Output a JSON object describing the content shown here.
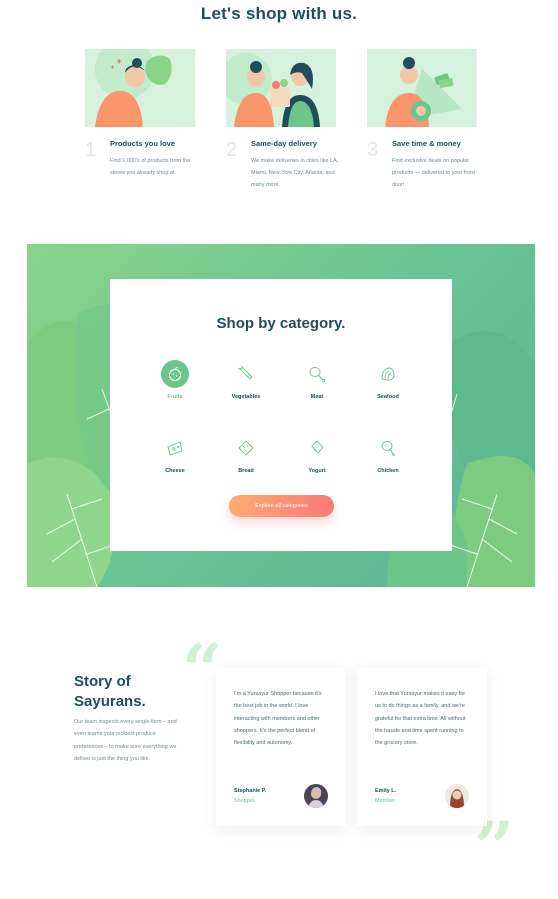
{
  "header": {
    "title": "Let's shop with us."
  },
  "features": [
    {
      "number": "1",
      "title": "Products you love",
      "description": "Find 1,000's of products from the stores you already shop at."
    },
    {
      "number": "2",
      "title": "Same-day delivery",
      "description": "We make deliveries in cities like LA, Miami, New York City, Atlanta, and many more."
    },
    {
      "number": "3",
      "title": "Save time & money",
      "description": "Find exclusive deals on popular products — delivered to your front door!"
    }
  ],
  "category": {
    "title": "Shop by category.",
    "items": [
      {
        "label": "Fruits",
        "icon": "fruit-icon",
        "active": true
      },
      {
        "label": "Vegetables",
        "icon": "vegetable-icon"
      },
      {
        "label": "Meat",
        "icon": "meat-icon"
      },
      {
        "label": "Seafood",
        "icon": "seafood-icon"
      },
      {
        "label": "Cheese",
        "icon": "cheese-icon"
      },
      {
        "label": "Bread",
        "icon": "bread-icon"
      },
      {
        "label": "Yogurt",
        "icon": "yogurt-icon"
      },
      {
        "label": "Chicken",
        "icon": "chicken-icon"
      }
    ],
    "button_label": "Explore all categories"
  },
  "story": {
    "title": "Story of Sayurans.",
    "description": "Our team inspects every single item – and even learns your pickiest produce preferences – to make sure everything we deliver is just the thing you like."
  },
  "testimonials": [
    {
      "text": "I'm a Yursayur Shopper because it's the best job in the world. I love interacting with members and other shoppers. It's the perfect blend of flexibility and autonomy.",
      "name": "Stephanie P.",
      "role": "Shopper"
    },
    {
      "text": "I love that Yursayur makes it easy for us to do things as a family, and we're grateful for that extra time. All without the hassle and time spent running to the grocery store.",
      "name": "Emily L.",
      "role": "Member"
    }
  ],
  "colors": {
    "brand_green": "#6cc58a",
    "dark_teal": "#1f4e5a",
    "accent_orange": "#fdab72",
    "accent_coral": "#f87a77"
  }
}
